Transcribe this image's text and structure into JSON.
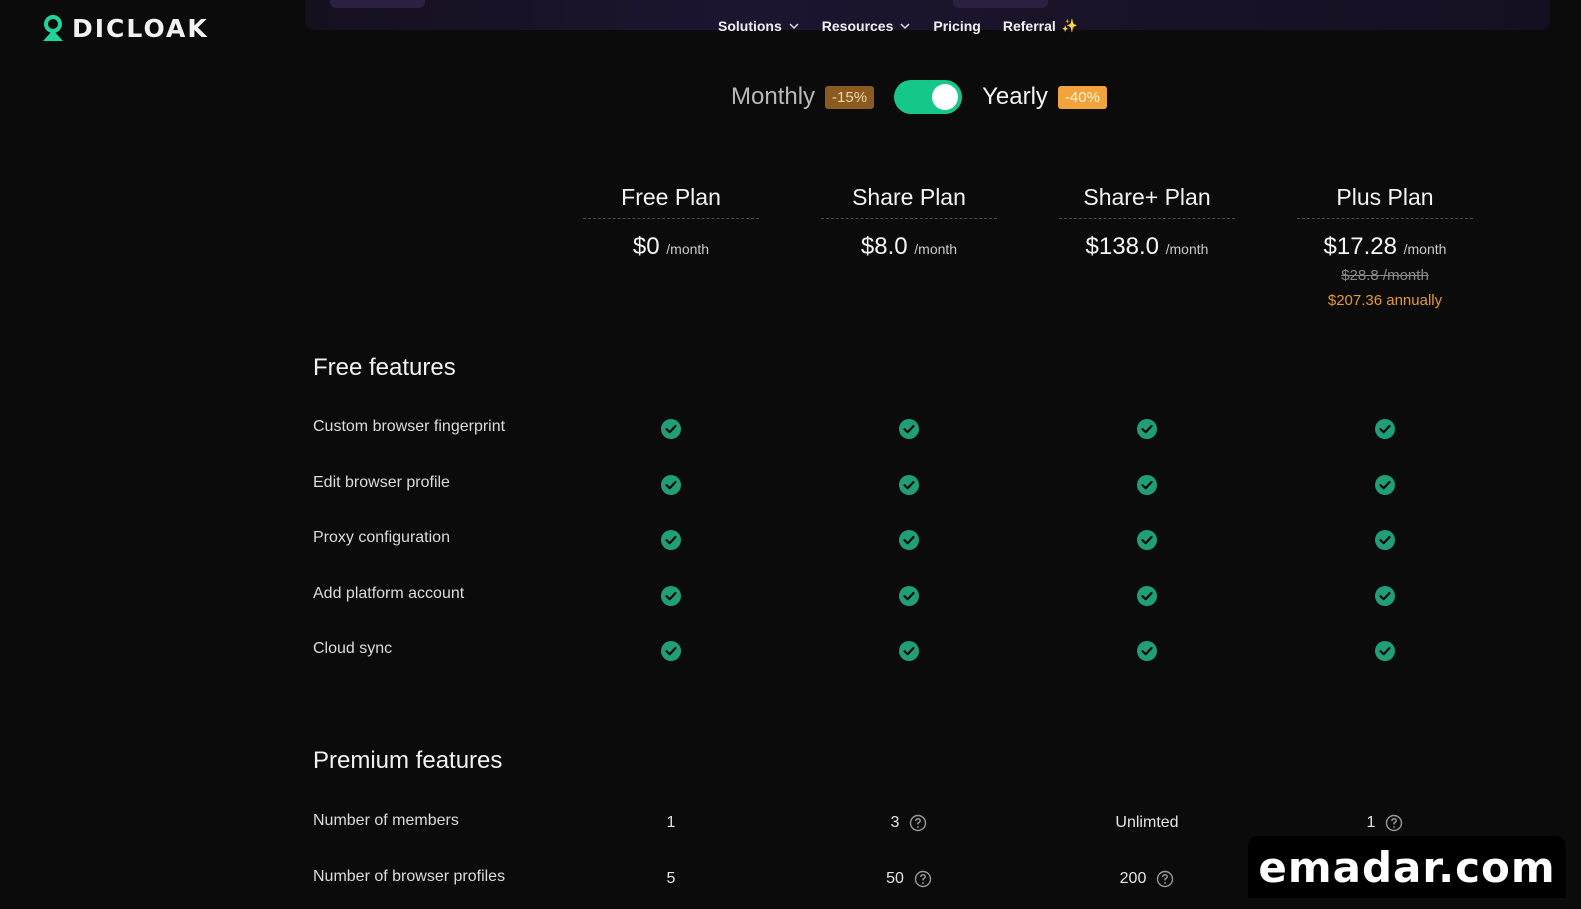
{
  "brand": {
    "logo_text": "DICLOAK"
  },
  "nav": {
    "items": [
      {
        "label": "Solutions",
        "has_dropdown": true
      },
      {
        "label": "Resources",
        "has_dropdown": true
      },
      {
        "label": "Pricing",
        "has_dropdown": false
      },
      {
        "label": "Referral",
        "has_dropdown": false,
        "spark": "✨"
      }
    ]
  },
  "billing": {
    "monthly_label": "Monthly",
    "monthly_badge": "-15%",
    "yearly_label": "Yearly",
    "yearly_badge": "-40%",
    "selected": "Yearly"
  },
  "plans": [
    {
      "name": "Free Plan",
      "price": "$0",
      "per": "/month"
    },
    {
      "name": "Share Plan",
      "price": "$8.0",
      "per": "/month"
    },
    {
      "name": "Share+ Plan",
      "price": "$138.0",
      "per": "/month"
    },
    {
      "name": "Plus Plan",
      "price": "$17.28",
      "per": "/month",
      "old_price": "$28.8 /month",
      "annual": "$207.36 annually"
    }
  ],
  "free_features": {
    "title": "Free features",
    "rows": [
      "Custom browser fingerprint",
      "Edit browser profile",
      "Proxy configuration",
      "Add platform account",
      "Cloud sync"
    ]
  },
  "premium_features": {
    "title": "Premium features",
    "rows": [
      {
        "label": "Number of members",
        "values": [
          "1",
          "3",
          "Unlimted",
          "1"
        ],
        "help": [
          false,
          true,
          false,
          true
        ]
      },
      {
        "label": "Number of browser profiles",
        "values": [
          "5",
          "50",
          "200",
          ""
        ],
        "help": [
          false,
          true,
          true,
          false
        ]
      }
    ]
  },
  "watermark": {
    "text": "emadar.com"
  },
  "colors": {
    "accent": "#16c78a",
    "check": "#1f9e78",
    "orange": "#f0a43b",
    "background": "#0b0b0b"
  }
}
